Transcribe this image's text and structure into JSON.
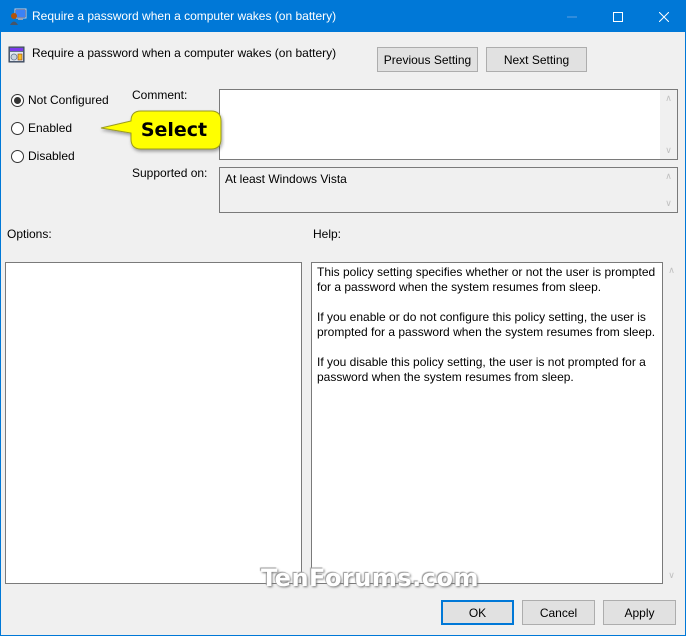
{
  "window": {
    "title": "Require a password when a computer wakes (on battery)",
    "app_icon": "group-policy-icon",
    "controls": {
      "minimize_icon": "minimize-icon",
      "minimize_enabled": false,
      "maximize_icon": "maximize-icon",
      "close_icon": "close-icon"
    },
    "accent_color": "#0078d7"
  },
  "header": {
    "icon": "policy-setting-icon",
    "title": "Require a password when a computer wakes (on battery)",
    "previous_label": "Previous Setting",
    "next_label": "Next Setting"
  },
  "state": {
    "options": [
      {
        "label": "Not Configured",
        "checked": true
      },
      {
        "label": "Enabled",
        "checked": false
      },
      {
        "label": "Disabled",
        "checked": false
      }
    ]
  },
  "comment": {
    "label": "Comment:",
    "value": ""
  },
  "supported": {
    "label": "Supported on:",
    "value": "At least Windows Vista"
  },
  "options_panel": {
    "label": "Options:"
  },
  "help_panel": {
    "label": "Help:",
    "paragraphs": [
      "This policy setting specifies whether or not the user is prompted for a password when the system resumes from sleep.",
      "If you enable or do not configure this policy setting, the user is prompted for a password when the system resumes from sleep.",
      "If you disable this policy setting, the user is not prompted for a password when the system resumes from sleep."
    ]
  },
  "footer": {
    "ok_label": "OK",
    "cancel_label": "Cancel",
    "apply_label": "Apply"
  },
  "annotation": {
    "callout_text": "Select",
    "callout_color": "#ffff00"
  },
  "watermark": {
    "text": "TenForums.com"
  }
}
